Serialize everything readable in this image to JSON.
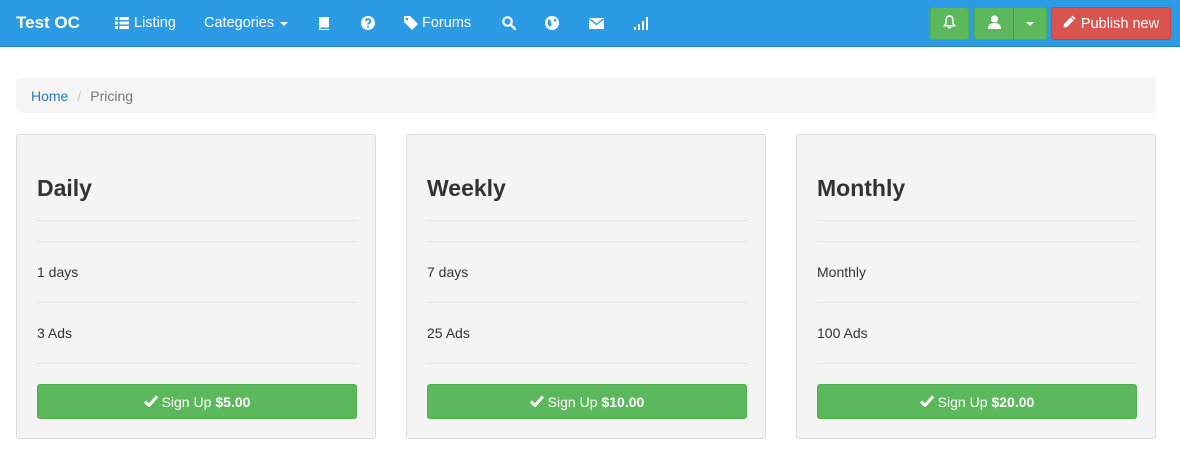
{
  "navbar": {
    "brand": "Test OC",
    "listing_label": "Listing",
    "categories_label": "Categories",
    "forums_label": "Forums",
    "icons": [
      "list-icon",
      "caret-down-icon",
      "book-icon",
      "question-circle-icon",
      "tag-icon",
      "search-icon",
      "globe-icon",
      "envelope-icon",
      "signal-icon",
      "bell-icon",
      "user-icon",
      "pencil-icon",
      "check-icon"
    ],
    "publish_label": "Publish new"
  },
  "breadcrumb": {
    "home": "Home",
    "separator": "/",
    "current": "Pricing"
  },
  "plans": [
    {
      "title": "Daily",
      "duration": "1 days",
      "ads": "3 Ads",
      "signup_label": "Sign Up",
      "price": "$5.00"
    },
    {
      "title": "Weekly",
      "duration": "7 days",
      "ads": "25 Ads",
      "signup_label": "Sign Up",
      "price": "$10.00"
    },
    {
      "title": "Monthly",
      "duration": "Monthly",
      "ads": "100 Ads",
      "signup_label": "Sign Up",
      "price": "$20.00"
    }
  ],
  "colors": {
    "navbar": "#2c9be6",
    "success": "#5cb85c",
    "danger": "#d9534f",
    "link": "#2a7ab8",
    "card_bg": "#f4f4f4"
  }
}
